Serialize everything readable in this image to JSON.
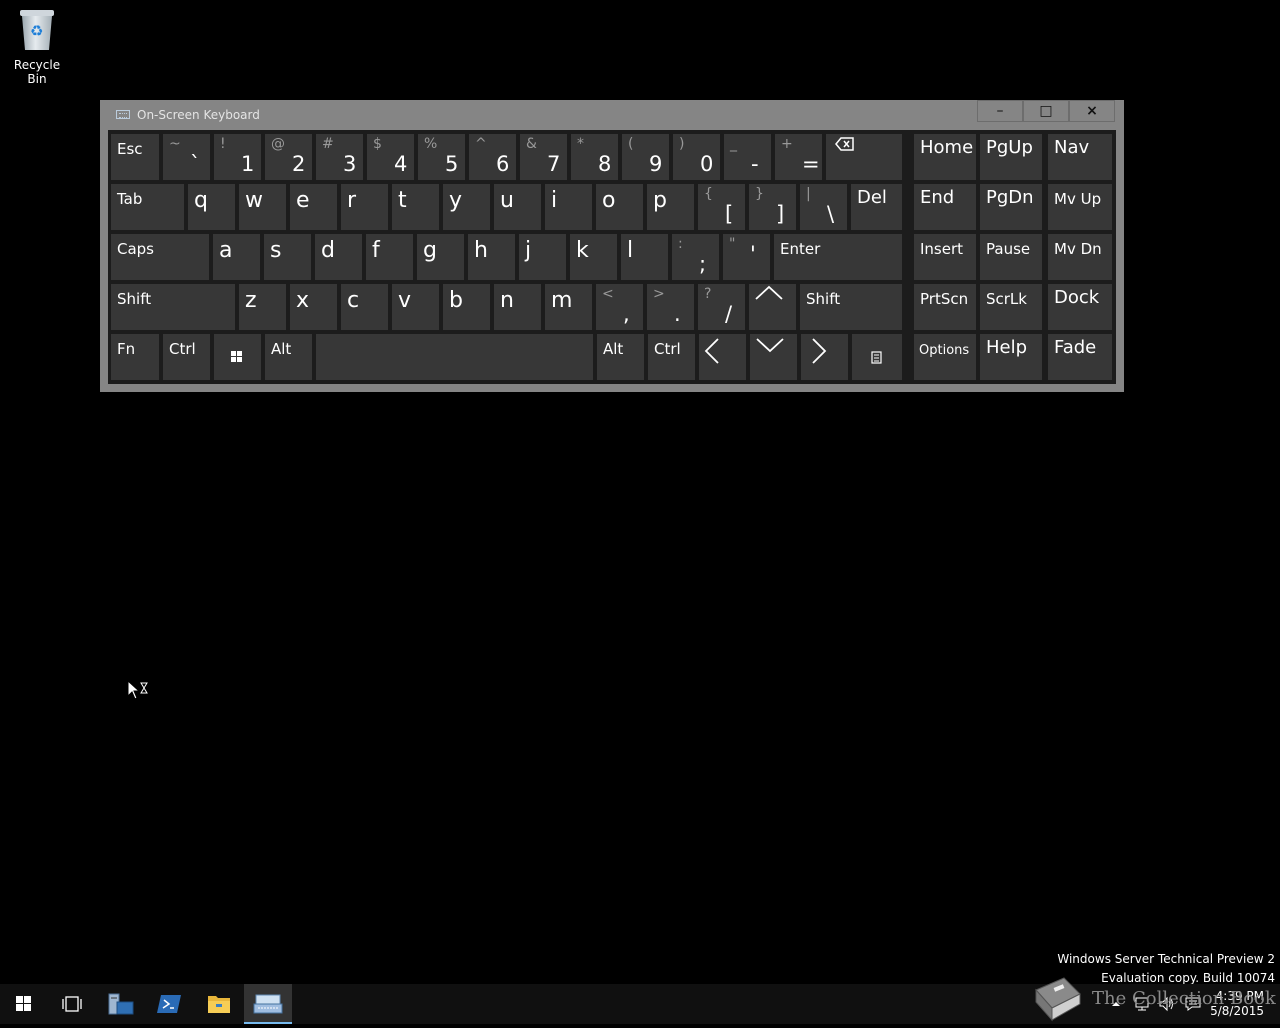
{
  "desktop": {
    "recycle_bin_label": "Recycle Bin"
  },
  "osk": {
    "title": "On-Screen Keyboard",
    "minimize_glyph": "–",
    "maximize_glyph": "□",
    "close_glyph": "×",
    "keys": {
      "esc": "Esc",
      "tilde_shift": "~",
      "tilde_base": "`",
      "1_shift": "!",
      "1_base": "1",
      "2_shift": "@",
      "2_base": "2",
      "3_shift": "#",
      "3_base": "3",
      "4_shift": "$",
      "4_base": "4",
      "5_shift": "%",
      "5_base": "5",
      "6_shift": "^",
      "6_base": "6",
      "7_shift": "&",
      "7_base": "7",
      "8_shift": "*",
      "8_base": "8",
      "9_shift": "(",
      "9_base": "9",
      "0_shift": ")",
      "0_base": "0",
      "minus_shift": "_",
      "minus_base": "-",
      "equals_shift": "+",
      "equals_base": "=",
      "home": "Home",
      "pgup": "PgUp",
      "nav": "Nav",
      "tab": "Tab",
      "q": "q",
      "w": "w",
      "e": "e",
      "r": "r",
      "t": "t",
      "y": "y",
      "u": "u",
      "i": "i",
      "o": "o",
      "p": "p",
      "lbracket_shift": "{",
      "lbracket_base": "[",
      "rbracket_shift": "}",
      "rbracket_base": "]",
      "backslash_shift": "|",
      "backslash_base": "\\",
      "del": "Del",
      "end": "End",
      "pgdn": "PgDn",
      "mvup": "Mv Up",
      "caps": "Caps",
      "a": "a",
      "s": "s",
      "d": "d",
      "f": "f",
      "g": "g",
      "h": "h",
      "j": "j",
      "k": "k",
      "l": "l",
      "semicolon_shift": ":",
      "semicolon_base": ";",
      "quote_shift": "\"",
      "quote_base": "'",
      "enter": "Enter",
      "insert": "Insert",
      "pause": "Pause",
      "mvdn": "Mv Dn",
      "shift": "Shift",
      "z": "z",
      "x": "x",
      "c": "c",
      "v": "v",
      "b": "b",
      "n": "n",
      "m": "m",
      "comma_shift": "<",
      "comma_base": ",",
      "period_shift": ">",
      "period_base": ".",
      "slash_shift": "?",
      "slash_base": "/",
      "prtscn": "PrtScn",
      "scrlk": "ScrLk",
      "dock": "Dock",
      "fn": "Fn",
      "ctrl": "Ctrl",
      "alt": "Alt",
      "options": "Options",
      "help": "Help",
      "fade": "Fade"
    }
  },
  "watermark": {
    "line1": "Windows Server Technical Preview 2",
    "line2": "Evaluation copy. Build 10074"
  },
  "overlay_brand": "The Collection Book",
  "taskbar": {
    "time": "4:39 PM",
    "date": "5/8/2015"
  }
}
